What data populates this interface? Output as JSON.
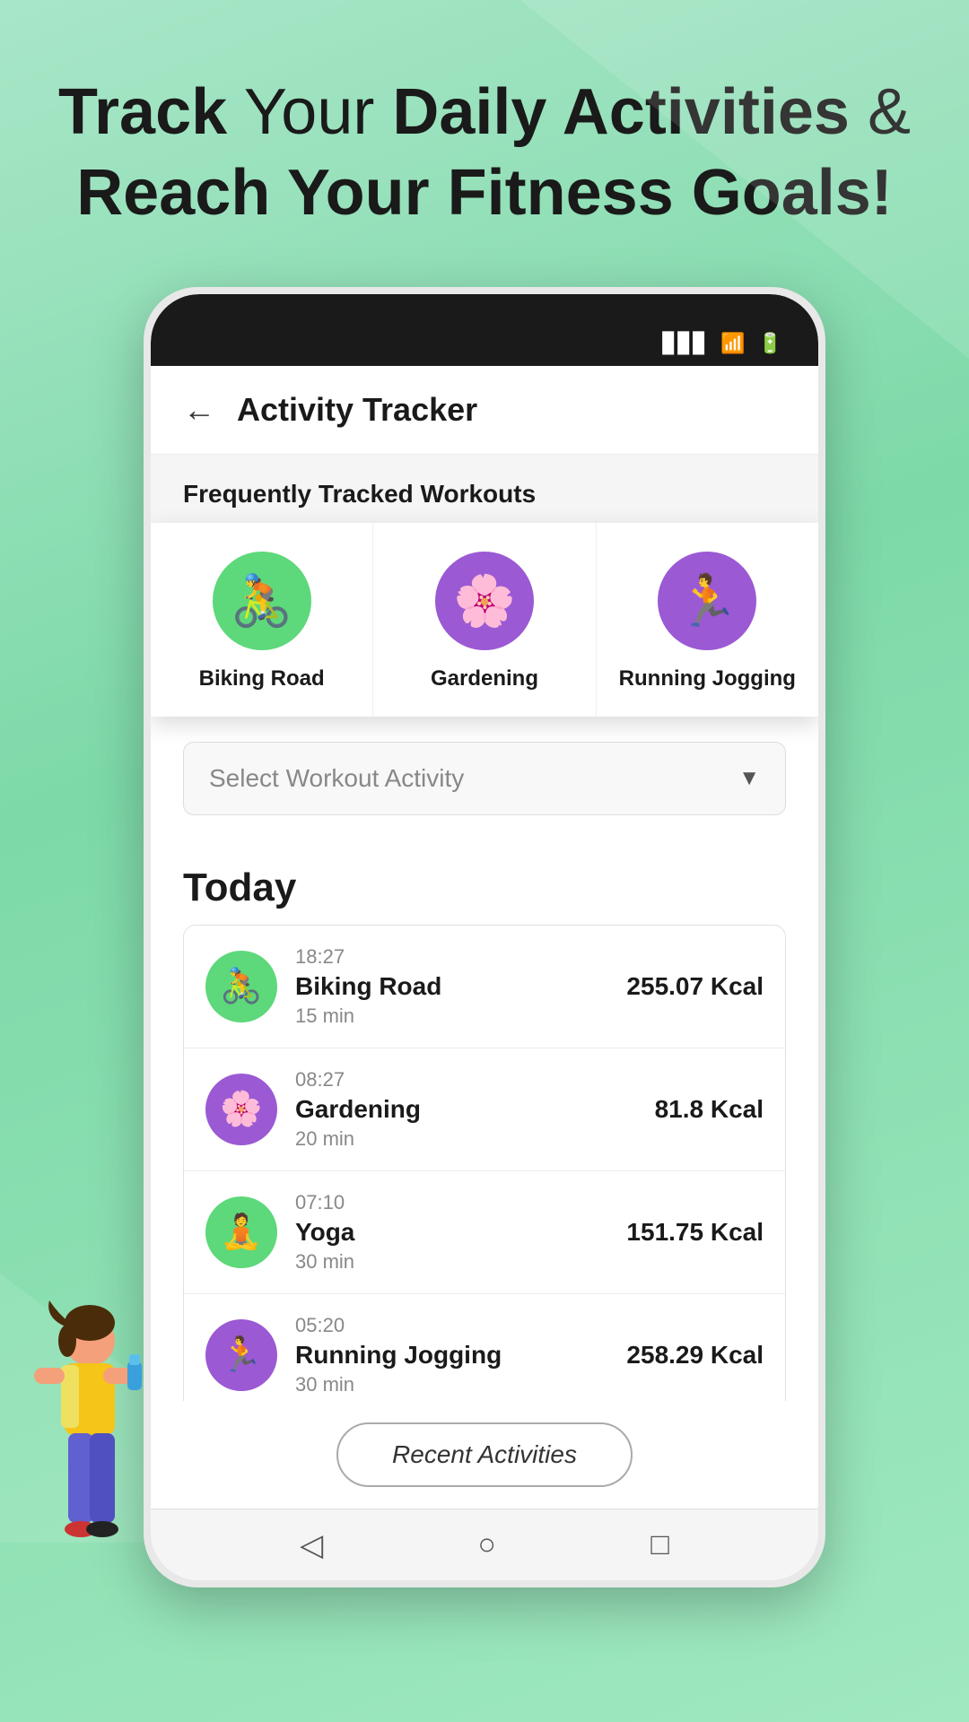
{
  "hero": {
    "line1_normal": "Track",
    "line1_bold": "Your",
    "line1_bold2": "Daily Activities",
    "line1_amp": "&",
    "line2": "Reach Your Fitness Goals!"
  },
  "app": {
    "back_label": "←",
    "title": "Activity Tracker"
  },
  "frequently_tracked": {
    "label": "Frequently Tracked Workouts",
    "cards": [
      {
        "id": "biking",
        "label": "Biking Road",
        "emoji": "🚴",
        "bg": "#5dd87a"
      },
      {
        "id": "gardening",
        "label": "Gardening",
        "emoji": "🌸",
        "bg": "#9b59d4"
      },
      {
        "id": "running",
        "label": "Running Jogging",
        "emoji": "🏃",
        "bg": "#9b59d4"
      }
    ]
  },
  "dropdown": {
    "placeholder": "Select Workout Activity",
    "arrow": "▼"
  },
  "today": {
    "label": "Today",
    "activities": [
      {
        "time": "18:27",
        "name": "Biking Road",
        "duration": "15 min",
        "kcal": "255.07 Kcal",
        "emoji": "🚴",
        "bg": "#5dd87a"
      },
      {
        "time": "08:27",
        "name": "Gardening",
        "duration": "20 min",
        "kcal": "81.8 Kcal",
        "emoji": "🌸",
        "bg": "#9b59d4"
      },
      {
        "time": "07:10",
        "name": "Yoga",
        "duration": "30 min",
        "kcal": "151.75 Kcal",
        "emoji": "🧘",
        "bg": "#5dd87a"
      },
      {
        "time": "05:20",
        "name": "Running Jogging",
        "duration": "30 min",
        "kcal": "258.29 Kcal",
        "emoji": "🏃",
        "bg": "#9b59d4"
      }
    ]
  },
  "bottom_btn": {
    "label": "Recent Activities"
  },
  "nav": {
    "back": "◁",
    "home": "○",
    "apps": "□"
  }
}
